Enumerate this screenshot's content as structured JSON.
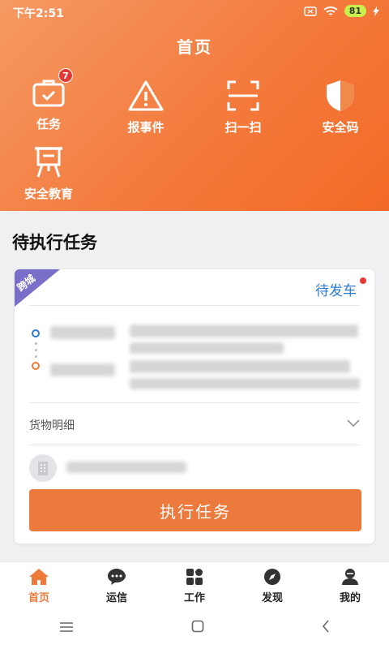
{
  "status_bar": {
    "time": "下午2:51",
    "battery": "81"
  },
  "header": {
    "title": "首页"
  },
  "menu": [
    {
      "label": "任务",
      "badge": "7",
      "icon": "task-icon"
    },
    {
      "label": "报事件",
      "icon": "warning-icon"
    },
    {
      "label": "扫一扫",
      "icon": "scan-icon"
    },
    {
      "label": "安全码",
      "icon": "shield-icon"
    },
    {
      "label": "安全教育",
      "icon": "education-icon"
    }
  ],
  "section": {
    "title": "待执行任务"
  },
  "task_card": {
    "tag": "跨城",
    "status": "待发车",
    "goods_label": "货物明细",
    "action_label": "执行任务"
  },
  "tabs": [
    {
      "label": "首页",
      "icon": "home-icon"
    },
    {
      "label": "运信",
      "icon": "message-icon"
    },
    {
      "label": "工作",
      "icon": "grid-icon"
    },
    {
      "label": "发现",
      "icon": "compass-icon"
    },
    {
      "label": "我的",
      "icon": "user-icon"
    }
  ],
  "colors": {
    "accent": "#ec7a3c",
    "status_blue": "#2d7bd6",
    "tag_purple": "#7a6fc8",
    "badge_red": "#e53935"
  }
}
